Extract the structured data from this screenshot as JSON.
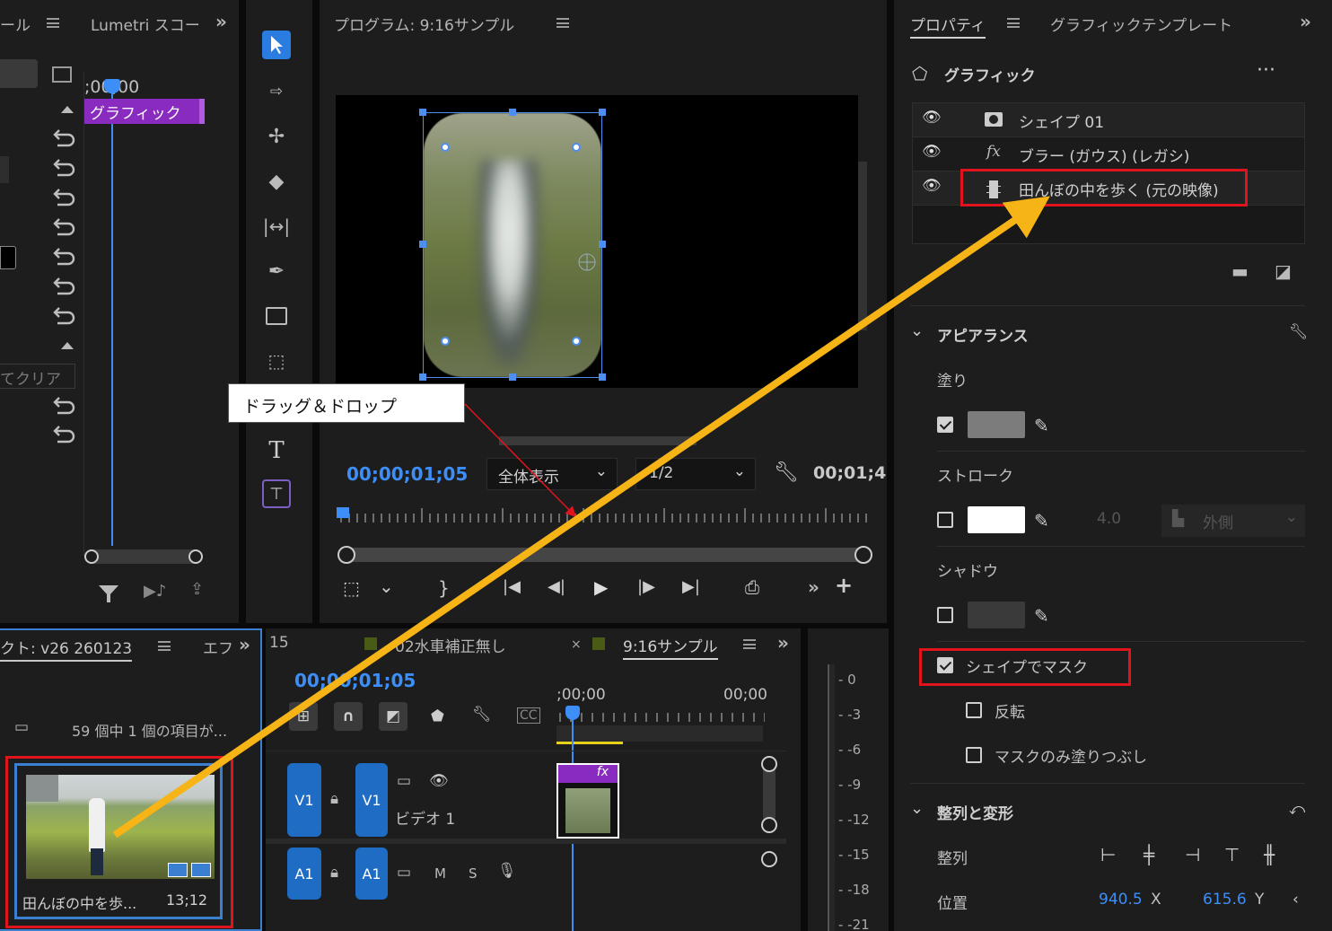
{
  "left_panel": {
    "tab1": "ール",
    "tab2": "Lumetri スコー",
    "time": ";00;00",
    "clip_label": "グラフィック",
    "clear_label": "てクリア"
  },
  "program": {
    "title": "プログラム: 9:16サンプル",
    "timecode": "00;00;01;05",
    "zoom": "全体表示",
    "resolution": "1/2",
    "duration": "00;01;4"
  },
  "annotation": {
    "text": "ドラッグ＆ドロップ",
    "arrow_color": "#f6b416",
    "callout_color": "#e0141d"
  },
  "properties": {
    "tab1": "プロパティ",
    "tab2": "グラフィックテンプレート",
    "section": "グラフィック",
    "layers": [
      {
        "name": "シェイプ 01",
        "icon": "shape-icon"
      },
      {
        "name": "ブラー (ガウス) (レガシ)",
        "icon": "fx-icon"
      },
      {
        "name": "田んぼの中を歩く (元の映像)",
        "icon": "film-icon"
      }
    ],
    "appearance": "アピアランス",
    "fill": "塗り",
    "stroke": "ストローク",
    "stroke_width": "4.0",
    "stroke_pos": "外側",
    "shadow": "シャドウ",
    "mask_shape": "シェイプでマスク",
    "invert": "反転",
    "mask_fill_only": "マスクのみ塗りつぶし",
    "align_section": "整列と変形",
    "align": "整列",
    "position": "位置",
    "pos_x": "940.5",
    "pos_x_unit": "X",
    "pos_y": "615.6",
    "pos_y_unit": "Y",
    "fill_color": "#7c7c7c",
    "stroke_color": "#ffffff",
    "fill_checked": true,
    "stroke_checked": false,
    "shadow_checked": false,
    "mask_checked": true,
    "invert_checked": false,
    "mask_fill_checked": false
  },
  "project": {
    "title": "クト: v26 260123",
    "tab2": "エフ",
    "count": "59 個中 1 個の項目が...",
    "clip_name": "田んぼの中を歩...",
    "clip_duration": "13;12"
  },
  "timeline": {
    "num": "15",
    "tab1": "02水車補正無し",
    "tab2": "9:16サンプル",
    "timecode": "00;00;01;05",
    "ruler1": ";00;00",
    "ruler2": "00;00",
    "v1": "V1",
    "a1": "A1",
    "video_label": "ビデオ 1",
    "m": "M",
    "s": "S",
    "fx": "fx"
  },
  "meter": [
    "0",
    "-3",
    "-6",
    "-9",
    "-12",
    "-15",
    "-18",
    "-21"
  ]
}
